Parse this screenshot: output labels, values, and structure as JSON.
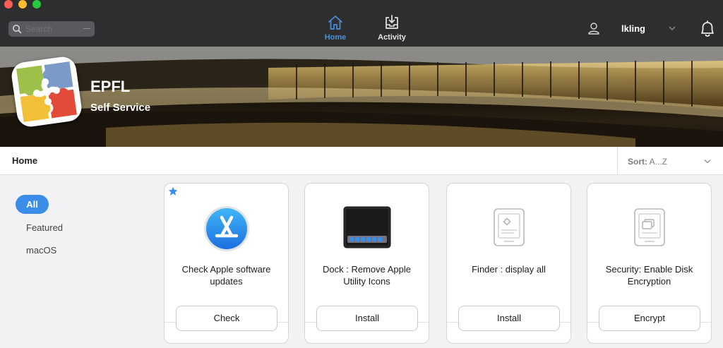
{
  "toolbar": {
    "search_placeholder": "Search",
    "nav": {
      "home": "Home",
      "activity": "Activity"
    },
    "user": "lkling",
    "accent_color": "#4a90d9"
  },
  "banner": {
    "title": "EPFL",
    "subtitle": "Self Service"
  },
  "breadcrumb": {
    "current": "Home"
  },
  "sort": {
    "label": "Sort:",
    "value": "A...Z"
  },
  "sidebar": {
    "items": [
      {
        "label": "All",
        "selected": true
      },
      {
        "label": "Featured",
        "selected": false
      },
      {
        "label": "macOS",
        "selected": false
      }
    ]
  },
  "cards": [
    {
      "name": "Check Apple software updates",
      "action": "Check",
      "icon": "app-store-icon",
      "featured": true
    },
    {
      "name": "Dock : Remove Apple Utility Icons",
      "action": "Install",
      "icon": "dock-screen-icon",
      "featured": false
    },
    {
      "name": "Finder : display all",
      "action": "Install",
      "icon": "policy-doc-icon",
      "featured": false
    },
    {
      "name": "Security: Enable Disk Encryption",
      "action": "Encrypt",
      "icon": "policy-doc-icon",
      "featured": false
    }
  ]
}
